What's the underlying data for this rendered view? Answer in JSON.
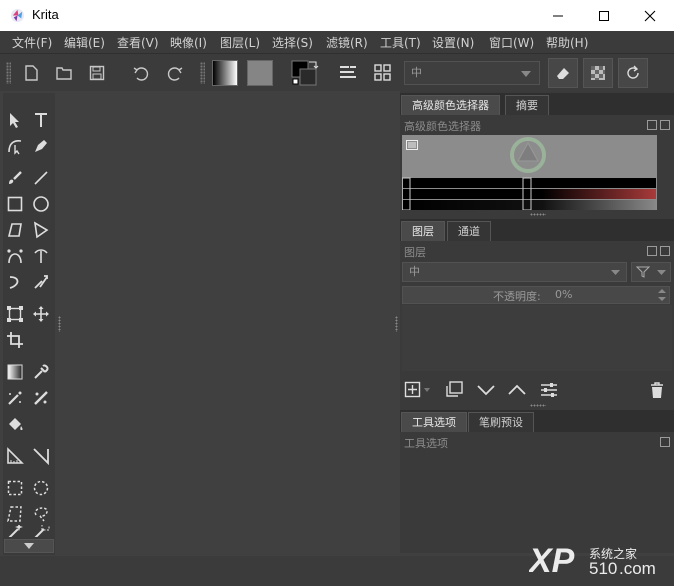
{
  "window": {
    "title": "Krita"
  },
  "menubar": {
    "items": [
      "文件(F)",
      "编辑(E)",
      "查看(V)",
      "映像(I)",
      "图层(L)",
      "选择(S)",
      "滤镜(R)",
      "工具(T)",
      "设置(N)",
      "窗口(W)",
      "帮助(H)"
    ]
  },
  "toolbar": {
    "blend_mode": "中"
  },
  "dock_top": {
    "tabs": [
      "高级颜色选择器",
      "摘要"
    ],
    "panel_title": "高级颜色选择器"
  },
  "dock_mid": {
    "tabs": [
      "图层",
      "通道"
    ],
    "panel_title": "图层",
    "blend_mode": "中",
    "opacity_label": "不透明度:",
    "opacity_value": "0%"
  },
  "dock_bottom": {
    "tabs": [
      "工具选项",
      "笔刷预设"
    ],
    "panel_title": "工具选项"
  },
  "watermark": {
    "brand": "XP",
    "number": "510",
    "dotcom": ".com",
    "cn": "系统之家"
  }
}
